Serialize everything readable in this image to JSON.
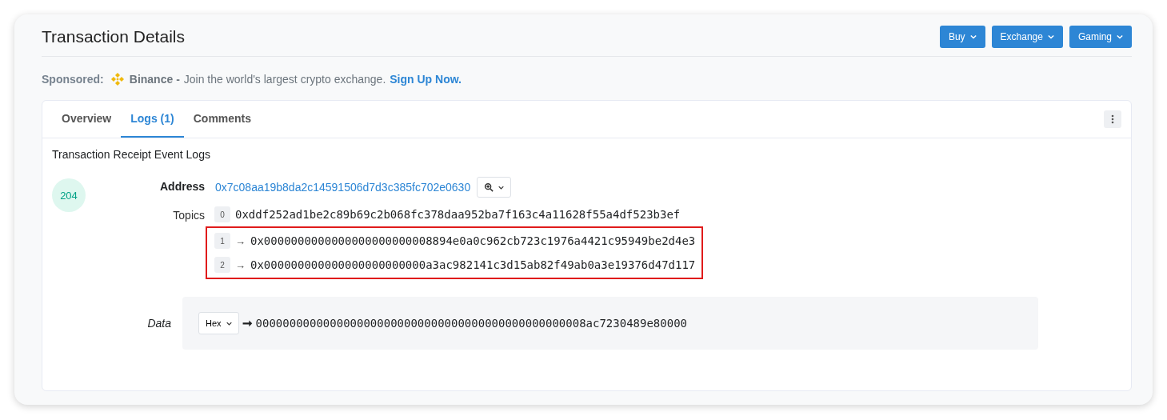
{
  "page_title": "Transaction Details",
  "header_buttons": [
    {
      "label": "Buy"
    },
    {
      "label": "Exchange"
    },
    {
      "label": "Gaming"
    }
  ],
  "sponsored": {
    "label": "Sponsored:",
    "brand": "Binance -",
    "text": "Join the world's largest crypto exchange.",
    "link": "Sign Up Now."
  },
  "tabs": [
    {
      "label": "Overview",
      "selected": false
    },
    {
      "label": "Logs (1)",
      "selected": true
    },
    {
      "label": "Comments",
      "selected": false
    }
  ],
  "section_title": "Transaction Receipt Event Logs",
  "log": {
    "index": "204",
    "address_label": "Address",
    "address": "0x7c08aa19b8da2c14591506d7d3c385fc702e0630",
    "topics_label": "Topics",
    "topics": [
      {
        "index": "0",
        "value": "0xddf252ad1be2c89b69c2b068fc378daa952ba7f163c4a11628f55a4df523b3ef",
        "highlighted": false
      },
      {
        "index": "1",
        "arrow": "→",
        "value": "0x0000000000000000000000008894e0a0c962cb723c1976a4421c95949be2d4e3",
        "highlighted": true
      },
      {
        "index": "2",
        "arrow": "→",
        "value": "0x000000000000000000000000a3ac982141c3d15ab82f49ab0a3e19376d47d117",
        "highlighted": true
      }
    ],
    "data_label": "Data",
    "data_format": "Hex",
    "data_arrow": "➞",
    "data_value": "0000000000000000000000000000000000000000000000008ac7230489e80000"
  }
}
